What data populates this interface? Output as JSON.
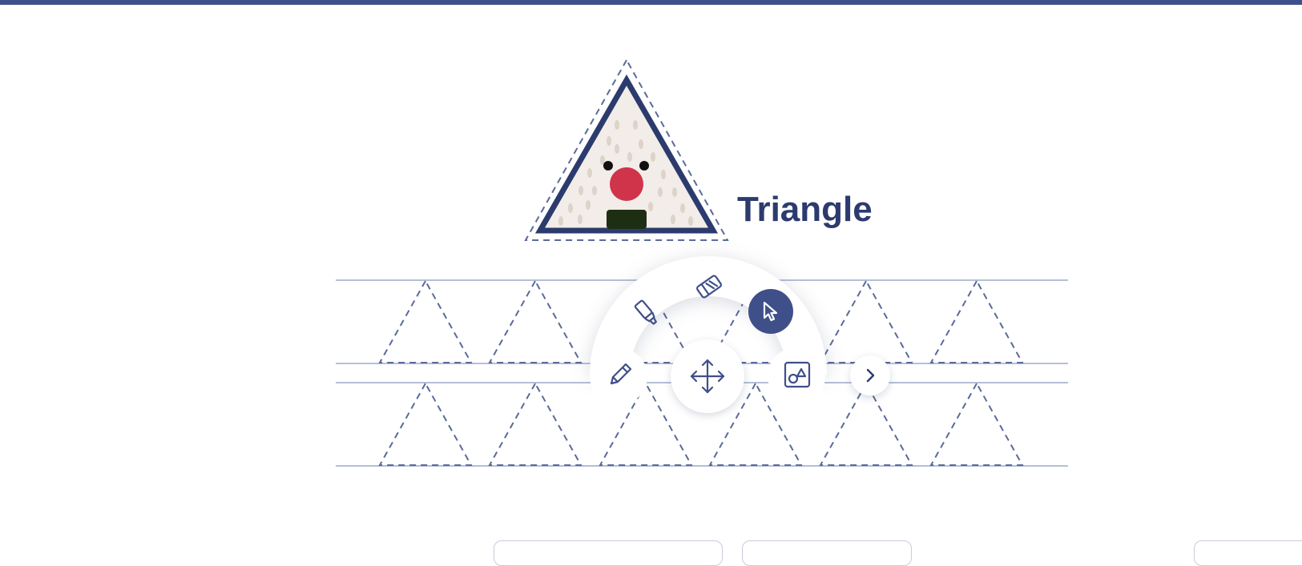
{
  "lesson": {
    "shape_name": "Triangle"
  },
  "toolbar": {
    "tools": [
      {
        "id": "highlighter",
        "icon": "highlighter-icon",
        "active": false
      },
      {
        "id": "eraser",
        "icon": "eraser-icon",
        "active": false
      },
      {
        "id": "select",
        "icon": "cursor-arrow-icon",
        "active": true
      },
      {
        "id": "pencil",
        "icon": "pencil-icon",
        "active": false
      },
      {
        "id": "move",
        "icon": "move-arrows-icon",
        "active": false
      },
      {
        "id": "shapes",
        "icon": "shapes-icon",
        "active": false
      },
      {
        "id": "next",
        "icon": "chevron-right-icon",
        "active": false
      }
    ]
  },
  "colors": {
    "brand": "#3f4f89",
    "active_tool": "#3f4f89",
    "mascot_nose": "#d0344a",
    "mascot_body": "#f2ede8",
    "mascot_mouth": "#1e2e12",
    "guide_line": "#b5bfd8",
    "dash": "#5a6a99"
  }
}
